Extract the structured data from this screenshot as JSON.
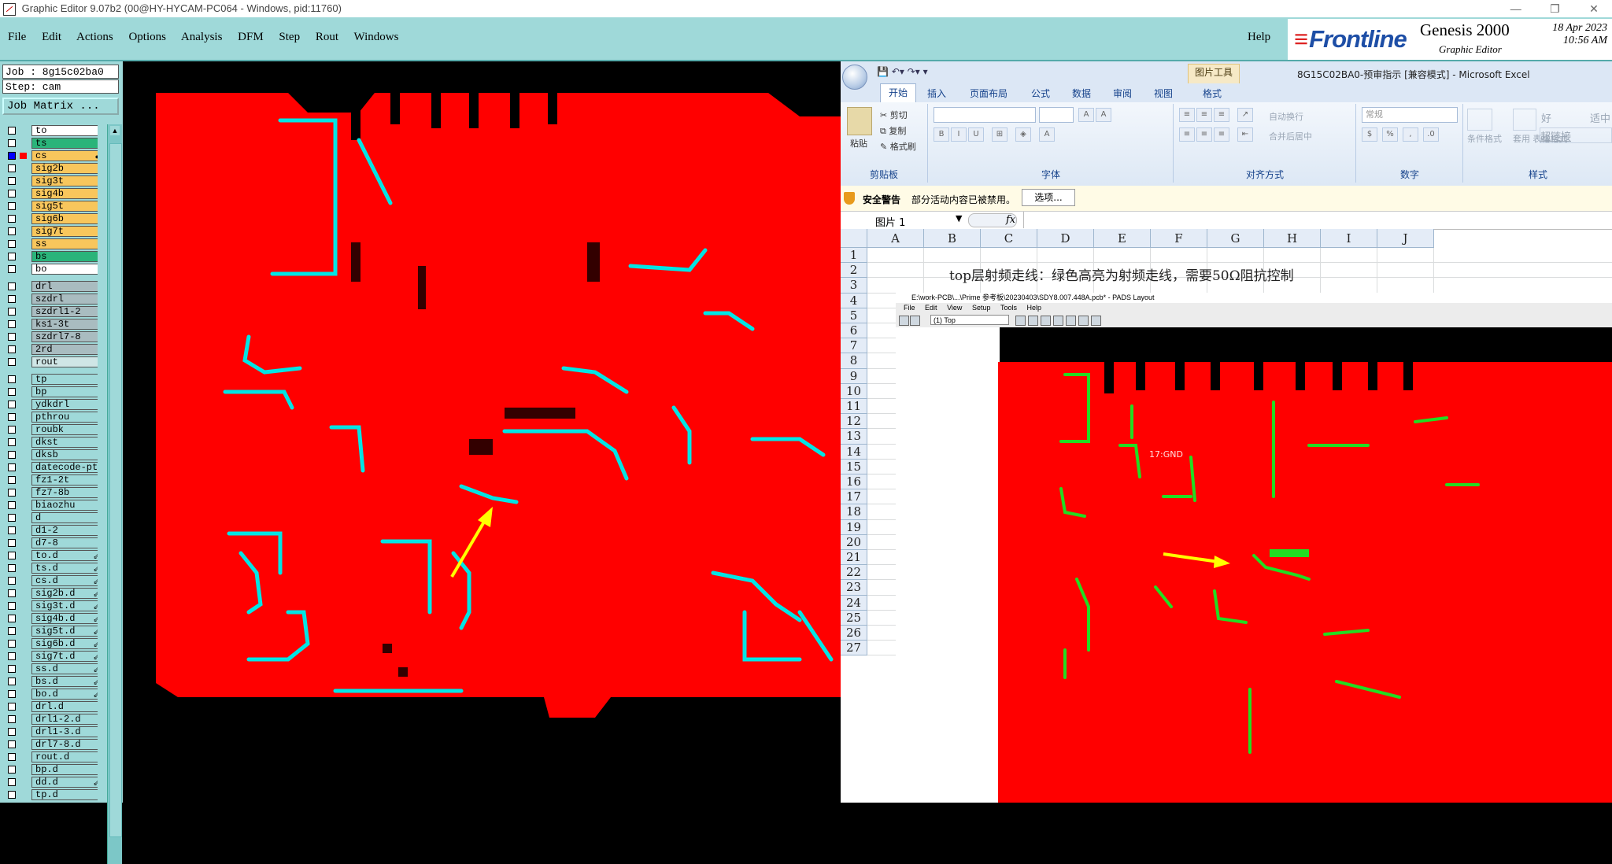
{
  "genesis": {
    "title": "Graphic Editor 9.07b2 (00@HY-HYCAM-PC064 - Windows, pid:11760)",
    "menu": [
      "File",
      "Edit",
      "Actions",
      "Options",
      "Analysis",
      "DFM",
      "Step",
      "Rout",
      "Windows"
    ],
    "help": "Help",
    "brand": {
      "logo": "Frontline",
      "product": "Genesis 2000",
      "subtitle": "Graphic Editor",
      "date": "18 Apr 2023",
      "time": "10:56 AM"
    },
    "job": "Job : 8g15c02ba0",
    "step": "Step: cam",
    "job_matrix": "Job Matrix ...",
    "layers": [
      {
        "name": "to",
        "style": "board",
        "checked": false,
        "swatch": ""
      },
      {
        "name": "ts",
        "style": "green",
        "checked": false,
        "swatch": ""
      },
      {
        "name": "cs",
        "style": "sig",
        "checked": true,
        "swatch": "#ff0000",
        "mark": "●"
      },
      {
        "name": "sig2b",
        "style": "sig",
        "checked": false,
        "swatch": ""
      },
      {
        "name": "sig3t",
        "style": "sig",
        "checked": false,
        "swatch": ""
      },
      {
        "name": "sig4b",
        "style": "sig",
        "checked": false,
        "swatch": ""
      },
      {
        "name": "sig5t",
        "style": "sig",
        "checked": false,
        "swatch": ""
      },
      {
        "name": "sig6b",
        "style": "sig",
        "checked": false,
        "swatch": ""
      },
      {
        "name": "sig7t",
        "style": "sig",
        "checked": false,
        "swatch": ""
      },
      {
        "name": "ss",
        "style": "sig",
        "checked": false,
        "swatch": ""
      },
      {
        "name": "bs",
        "style": "green",
        "checked": false,
        "swatch": ""
      },
      {
        "name": "bo",
        "style": "board",
        "checked": false,
        "swatch": ""
      },
      {
        "sep": true
      },
      {
        "name": "drl",
        "style": "gray",
        "checked": false,
        "swatch": ""
      },
      {
        "name": "szdrl",
        "style": "gray",
        "checked": false,
        "swatch": ""
      },
      {
        "name": "szdrl1-2",
        "style": "gray",
        "checked": false,
        "swatch": ""
      },
      {
        "name": "ks1-3t",
        "style": "gray",
        "checked": false,
        "swatch": ""
      },
      {
        "name": "szdrl7-8",
        "style": "gray",
        "checked": false,
        "swatch": ""
      },
      {
        "name": "2rd",
        "style": "gray",
        "checked": false,
        "swatch": ""
      },
      {
        "name": "rout",
        "style": "drill",
        "checked": false,
        "swatch": ""
      },
      {
        "sep": true
      },
      {
        "name": "tp",
        "style": "",
        "checked": false,
        "swatch": ""
      },
      {
        "name": "bp",
        "style": "",
        "checked": false,
        "swatch": ""
      },
      {
        "name": "ydkdrl",
        "style": "",
        "checked": false,
        "swatch": ""
      },
      {
        "name": "pthrou",
        "style": "",
        "checked": false,
        "swatch": ""
      },
      {
        "name": "roubk",
        "style": "",
        "checked": false,
        "swatch": ""
      },
      {
        "name": "dkst",
        "style": "",
        "checked": false,
        "swatch": ""
      },
      {
        "name": "dksb",
        "style": "",
        "checked": false,
        "swatch": ""
      },
      {
        "name": "datecode-pt",
        "style": "",
        "checked": false,
        "swatch": ""
      },
      {
        "name": "fz1-2t",
        "style": "",
        "checked": false,
        "swatch": ""
      },
      {
        "name": "fz7-8b",
        "style": "",
        "checked": false,
        "swatch": ""
      },
      {
        "name": "biaozhu",
        "style": "",
        "checked": false,
        "swatch": ""
      },
      {
        "name": "d",
        "style": "",
        "checked": false,
        "swatch": ""
      },
      {
        "name": "d1-2",
        "style": "",
        "checked": false,
        "swatch": ""
      },
      {
        "name": "d7-8",
        "style": "",
        "checked": false,
        "swatch": ""
      },
      {
        "name": "to.d",
        "style": "",
        "checked": false,
        "swatch": "",
        "mark": "⇙"
      },
      {
        "name": "ts.d",
        "style": "",
        "checked": false,
        "swatch": "",
        "mark": "⇙"
      },
      {
        "name": "cs.d",
        "style": "",
        "checked": false,
        "swatch": "",
        "mark": "⇙"
      },
      {
        "name": "sig2b.d",
        "style": "",
        "checked": false,
        "swatch": "",
        "mark": "⇙"
      },
      {
        "name": "sig3t.d",
        "style": "",
        "checked": false,
        "swatch": "",
        "mark": "⇙"
      },
      {
        "name": "sig4b.d",
        "style": "",
        "checked": false,
        "swatch": "",
        "mark": "⇙"
      },
      {
        "name": "sig5t.d",
        "style": "",
        "checked": false,
        "swatch": "",
        "mark": "⇙"
      },
      {
        "name": "sig6b.d",
        "style": "",
        "checked": false,
        "swatch": "",
        "mark": "⇙"
      },
      {
        "name": "sig7t.d",
        "style": "",
        "checked": false,
        "swatch": "",
        "mark": "⇙"
      },
      {
        "name": "ss.d",
        "style": "",
        "checked": false,
        "swatch": "",
        "mark": "⇙"
      },
      {
        "name": "bs.d",
        "style": "",
        "checked": false,
        "swatch": "",
        "mark": "⇙"
      },
      {
        "name": "bo.d",
        "style": "",
        "checked": false,
        "swatch": "",
        "mark": "⇙"
      },
      {
        "name": "drl.d",
        "style": "",
        "checked": false,
        "swatch": ""
      },
      {
        "name": "drl1-2.d",
        "style": "",
        "checked": false,
        "swatch": ""
      },
      {
        "name": "drl1-3.d",
        "style": "",
        "checked": false,
        "swatch": ""
      },
      {
        "name": "drl7-8.d",
        "style": "",
        "checked": false,
        "swatch": ""
      },
      {
        "name": "rout.d",
        "style": "",
        "checked": false,
        "swatch": ""
      },
      {
        "name": "bp.d",
        "style": "",
        "checked": false,
        "swatch": ""
      },
      {
        "name": "dd.d",
        "style": "",
        "checked": false,
        "swatch": "",
        "mark": "⇙"
      },
      {
        "name": "tp.d",
        "style": "",
        "checked": false,
        "swatch": ""
      }
    ]
  },
  "excel": {
    "context_tab": "图片工具",
    "window_title": "8G15C02BA0-预审指示  [兼容模式] - Microsoft Excel",
    "tabs": [
      "开始",
      "插入",
      "页面布局",
      "公式",
      "数据",
      "审阅",
      "视图",
      "格式"
    ],
    "clipboard": {
      "paste": "粘贴",
      "cut": "剪切",
      "copy": "复制",
      "format_painter": "格式刷",
      "label": "剪贴板"
    },
    "font_label": "字体",
    "align": {
      "wrap": "自动换行",
      "merge": "合并后居中",
      "label": "对齐方式"
    },
    "number": {
      "format": "常规",
      "label": "数字"
    },
    "styles": {
      "conditional": "条件格式",
      "table": "套用\n表格格式",
      "good": "好",
      "hyperlink": "超链接",
      "neutral": "适中",
      "label": "样式"
    },
    "security": {
      "title": "安全警告",
      "message": "部分活动内容已被禁用。",
      "button": "选项..."
    },
    "name_box": "图片 1",
    "fx": "fx",
    "columns": [
      "A",
      "B",
      "C",
      "D",
      "E",
      "F",
      "G",
      "H",
      "I",
      "J"
    ],
    "rows": [
      "1",
      "2",
      "3",
      "4",
      "5",
      "6",
      "7",
      "8",
      "9",
      "10",
      "11",
      "12",
      "13",
      "14",
      "15",
      "16",
      "17",
      "18",
      "19",
      "20",
      "21",
      "22",
      "23",
      "24",
      "25",
      "26",
      "27"
    ],
    "cell_b1": "top层射频走线：绿色高亮为射频走线，需要50Ω阻抗控制"
  },
  "pads": {
    "title": "E:\\work-PCB\\...\\Prime 参考板\\20230403\\SDY8.007.448A.pcb* - PADS Layout",
    "menu": [
      "File",
      "Edit",
      "View",
      "Setup",
      "Tools",
      "Help"
    ],
    "layer_combo": "(1) Top",
    "label": "17:GND"
  },
  "colors": {
    "board_red": "#ff0000",
    "trace_cyan": "#00e5e5",
    "trace_green": "#22dd22",
    "arrow_yellow": "#ffff00",
    "panel_teal": "#9fd9d9"
  }
}
